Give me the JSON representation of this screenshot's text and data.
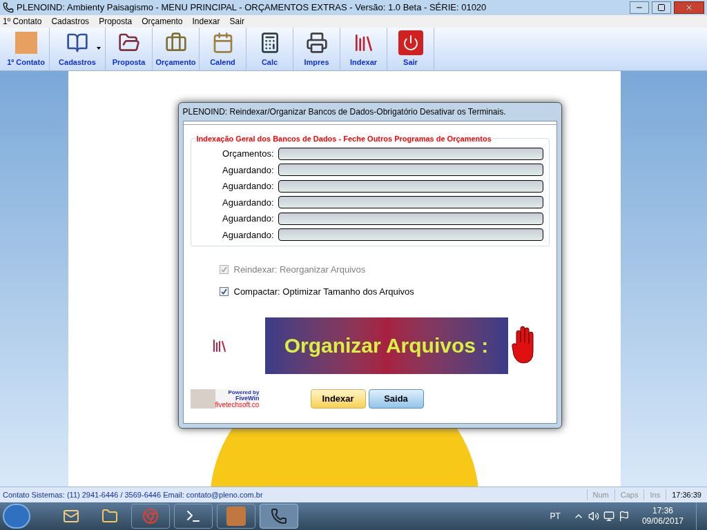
{
  "window": {
    "title": "PLENOIND: Ambienty Paisagismo - MENU PRINCIPAL - ORÇAMENTOS EXTRAS - Versão: 1.0 Beta - SÉRIE: 01020"
  },
  "menu": [
    "1º Contato",
    "Cadastros",
    "Proposta",
    "Orçamento",
    "Indexar",
    "Sair"
  ],
  "toolbar": [
    {
      "label": "1º Contato",
      "kind": "portrait",
      "dropdown": false
    },
    {
      "label": "Cadastros",
      "kind": "book",
      "dropdown": true
    },
    {
      "label": "Proposta",
      "kind": "folder",
      "dropdown": false
    },
    {
      "label": "Orçamento",
      "kind": "briefcase",
      "dropdown": false
    },
    {
      "label": "Calend",
      "kind": "calendar",
      "dropdown": false
    },
    {
      "label": "Calc",
      "kind": "calculator",
      "dropdown": false
    },
    {
      "label": "Impres",
      "kind": "printer",
      "dropdown": false
    },
    {
      "label": "Indexar",
      "kind": "books",
      "dropdown": false
    },
    {
      "label": "Sair",
      "kind": "power",
      "dropdown": false
    }
  ],
  "dialog": {
    "title": "PLENOIND: Reindexar/Organizar Bancos de Dados-Obrigatório Desativar os Terminais.",
    "group_title": "Indexação Geral dos Bancos de Dados - Feche Outros Programas de Orçamentos",
    "progress": [
      {
        "label": "Orçamentos:",
        "level": 0
      },
      {
        "label": "Aguardando:",
        "level": 0
      },
      {
        "label": "Aguardando:",
        "level": 0
      },
      {
        "label": "Aguardando:",
        "level": 0
      },
      {
        "label": "Aguardando:",
        "level": 0
      },
      {
        "label": "Aguardando:",
        "level": 0
      }
    ],
    "options": [
      {
        "label": "Reindexar: Reorganizar Arquivos",
        "checked": true,
        "disabled": true
      },
      {
        "label": "Compactar: Optimizar Tamanho dos Arquivos",
        "checked": true,
        "disabled": false
      }
    ],
    "banner": "Organizar Arquivos :",
    "logo": {
      "line_1": "Powered by",
      "line_2": "FiveWin",
      "line_3": "fivetechsoft.co"
    },
    "buttons": [
      {
        "label": "Indexar",
        "kind": "primary"
      },
      {
        "label": "Saida",
        "kind": "secondary"
      }
    ]
  },
  "status_bar": {
    "text": "Contato Sistemas: (11) 2941-6446 / 3569-6446 Email: contato@pleno.com.br",
    "panels": [
      "Num",
      "Caps",
      "Ins",
      "17:36:39"
    ]
  },
  "taskbar": {
    "language": "PT",
    "time": "17:36",
    "date": "09/06/2017"
  }
}
